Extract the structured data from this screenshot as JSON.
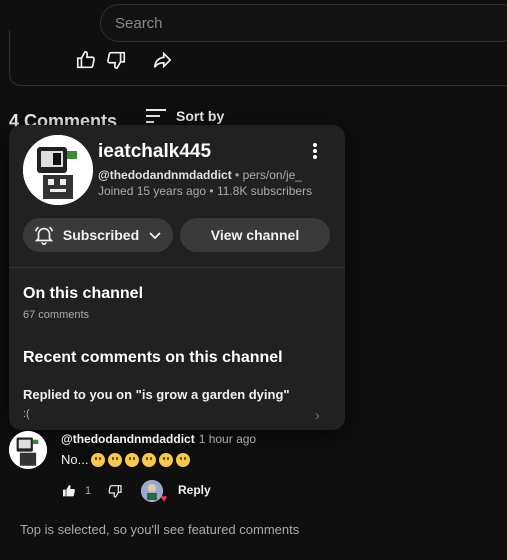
{
  "search": {
    "placeholder": "Search"
  },
  "comments_header": {
    "count_label": "4 Comments",
    "sort_label": "Sort by"
  },
  "popup": {
    "channel_name": "ieatchalk445",
    "handle": "@thedodandnmdaddict",
    "handle_extra": "• pers/on/je_",
    "joined": "Joined 15 years ago • 11.8K subscribers",
    "subscribed_label": "Subscribed",
    "view_channel_label": "View channel",
    "on_channel_title": "On this channel",
    "on_channel_count": "67 comments",
    "recent_title": "Recent comments on this channel",
    "recent_item_title": "Replied to you on \"is grow a garden dying\"",
    "recent_item_text": ":("
  },
  "comment": {
    "author": "@thedodandnmdaddict",
    "time": "1 hour ago",
    "text": "No...",
    "emoji_count": 6,
    "likes": "1",
    "reply_label": "Reply"
  },
  "footer": {
    "text": "Top is selected, so you'll see featured comments"
  },
  "colors": {
    "background": "#0f0f0f",
    "popup": "#212121",
    "heart": "#ff2f4f"
  }
}
